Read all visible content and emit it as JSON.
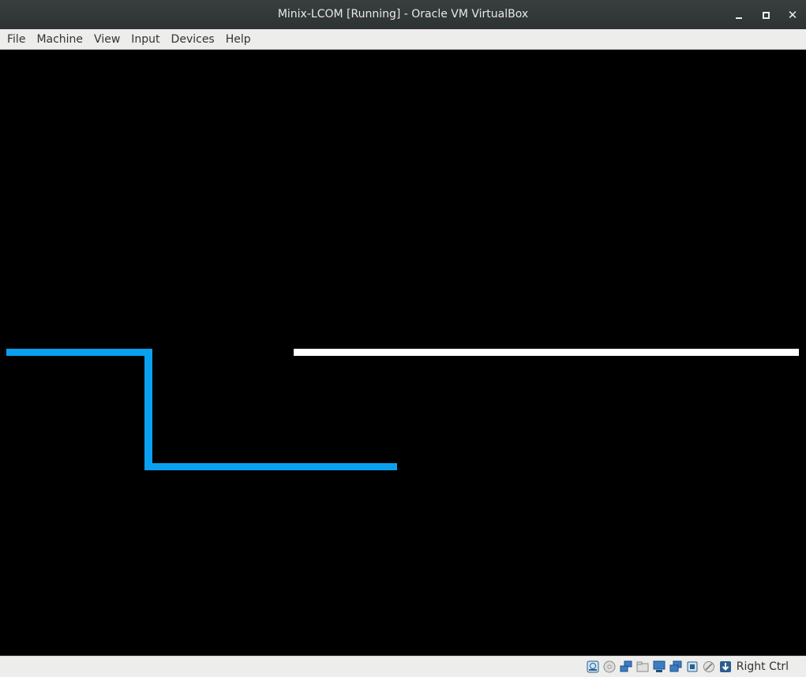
{
  "window": {
    "title": "Minix-LCOM [Running] - Oracle VM VirtualBox"
  },
  "menubar": {
    "items": [
      "File",
      "Machine",
      "View",
      "Input",
      "Devices",
      "Help"
    ]
  },
  "screen": {
    "colors": {
      "background": "#000000",
      "player_trail": "#0aa0f0",
      "opponent_trail": "#ffffff"
    }
  },
  "statusbar": {
    "icons": [
      "hard-disk-icon",
      "optical-drive-icon",
      "network-icon",
      "shared-folders-icon",
      "display-icon",
      "video-capture-icon",
      "cpu-icon",
      "mouse-integration-icon",
      "keyboard-capture-icon"
    ],
    "host_key": "Right Ctrl"
  }
}
